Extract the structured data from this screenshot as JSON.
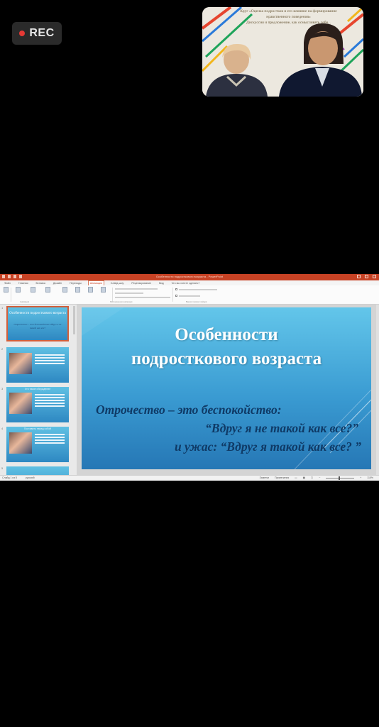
{
  "recorder": {
    "label": "REC",
    "dot_color": "#e53935"
  },
  "video": {
    "caption_line1": "Круг «Оценка подростков и его влияние на формирование",
    "caption_line2": "нравственного поведения»",
    "caption_line3": "Дискуссия и предложение, как осмысливать себя..."
  },
  "powerpoint": {
    "window_title": "Особенности подросткового возраста - PowerPoint",
    "tabs": [
      "Файл",
      "Главная",
      "Вставка",
      "Дизайн",
      "Переходы",
      "Анимация",
      "Слайд-шоу",
      "Рецензирование",
      "Вид",
      "Что вы хотите сделать?"
    ],
    "active_tab_index": 5,
    "ribbon_groups": [
      "Просмотр",
      "Анимация",
      "Расширенная анимация",
      "Время показа слайдов"
    ],
    "thumbnails": [
      {
        "num": "1",
        "title": "Особенности подросткового возраста",
        "subtitle": "Отрочество – это беспокойство: Вдруг я не такой как все?"
      },
      {
        "num": "2",
        "title": ""
      },
      {
        "num": "3",
        "title": "Что такое обсуждение"
      },
      {
        "num": "4",
        "title": "Поставить перед собой"
      },
      {
        "num": "5",
        "title": ""
      }
    ],
    "slide": {
      "title_line1": "Особенности",
      "title_line2": "подросткового возраста",
      "sub_line1": "Отрочество – это беспокойство:",
      "sub_line2": "“Вдруг я не такой как все?”",
      "sub_line3": "и ужас: “Вдруг я такой как все? ”"
    },
    "status": {
      "slide_counter": "Слайд 1 из 8",
      "language": "русский",
      "notes": "Заметки",
      "comments": "Примечания",
      "zoom": "115%"
    },
    "accent": "#c74224"
  }
}
